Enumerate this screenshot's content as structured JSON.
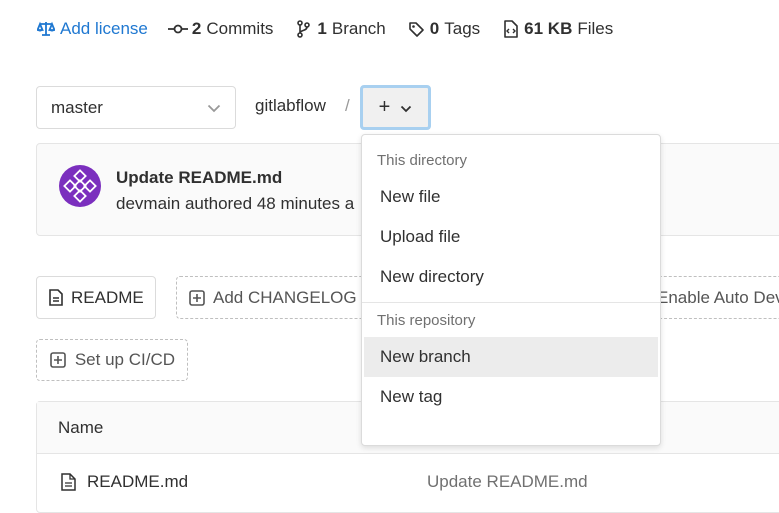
{
  "stats": {
    "license": "Add license",
    "commits_count": "2",
    "commits_label": "Commits",
    "branch_count": "1",
    "branch_label": "Branch",
    "tags_count": "0",
    "tags_label": "Tags",
    "files_size": "61 KB",
    "files_label": "Files"
  },
  "nav": {
    "ref": "master",
    "path": "gitlabflow",
    "separator": "/",
    "add_symbol": "+"
  },
  "commit": {
    "title": "Update README.md",
    "meta": "devmain authored 48 minutes a"
  },
  "actions": {
    "readme": "README",
    "changelog": "Add CHANGELOG",
    "auto_devops": "Enable Auto Dev",
    "cicd": "Set up CI/CD"
  },
  "table": {
    "header_name": "Name",
    "rows": [
      {
        "name": "README.md",
        "commit": "Update README.md"
      }
    ]
  },
  "dropdown": {
    "section1": "This directory",
    "items1": [
      "New file",
      "Upload file",
      "New directory"
    ],
    "section2": "This repository",
    "items2": [
      "New branch",
      "New tag"
    ]
  },
  "colors": {
    "link": "#1f78d1",
    "avatar": "#7b2fbe",
    "focus_ring": "#a8d0f0"
  }
}
